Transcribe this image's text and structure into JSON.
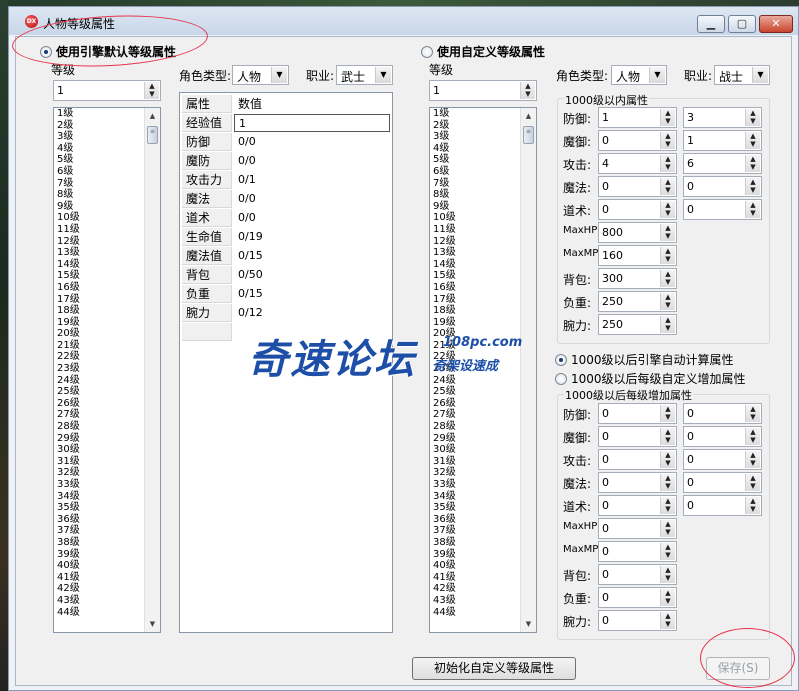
{
  "window": {
    "title": "人物等级属性",
    "icon_text": "DX"
  },
  "left_panel": {
    "radio_label": "使用引擎默认等级属性",
    "level_label": "等级",
    "level_value": "1",
    "role_type_label": "角色类型:",
    "role_type_value": "人物",
    "job_label": "职业:",
    "job_value": "武士",
    "grid_header": {
      "attr": "属性",
      "value": "数值"
    },
    "grid_rows": [
      {
        "name": "经验值",
        "value": "1"
      },
      {
        "name": "防御",
        "value": "0/0"
      },
      {
        "name": "魔防",
        "value": "0/0"
      },
      {
        "name": "攻击力",
        "value": "0/1"
      },
      {
        "name": "魔法",
        "value": "0/0"
      },
      {
        "name": "道术",
        "value": "0/0"
      },
      {
        "name": "生命值",
        "value": "0/19"
      },
      {
        "name": "魔法值",
        "value": "0/15"
      },
      {
        "name": "背包",
        "value": "0/50"
      },
      {
        "name": "负重",
        "value": "0/15"
      },
      {
        "name": "腕力",
        "value": "0/12"
      }
    ]
  },
  "right_panel": {
    "radio_label": "使用自定义等级属性",
    "level_label": "等级",
    "level_value": "1",
    "role_type_label": "角色类型:",
    "role_type_value": "人物",
    "job_label": "职业:",
    "job_value": "战士",
    "group1_label": "1000级以内属性",
    "group1_rows": [
      {
        "label": "防御:",
        "v1": "1",
        "v2": "3"
      },
      {
        "label": "魔御:",
        "v1": "0",
        "v2": "1"
      },
      {
        "label": "攻击:",
        "v1": "4",
        "v2": "6"
      },
      {
        "label": "魔法:",
        "v1": "0",
        "v2": "0"
      },
      {
        "label": "道术:",
        "v1": "0",
        "v2": "0"
      },
      {
        "label": "MaxHP",
        "v1": "800"
      },
      {
        "label": "MaxMP",
        "v1": "160"
      },
      {
        "label": "背包:",
        "v1": "300"
      },
      {
        "label": "负重:",
        "v1": "250"
      },
      {
        "label": "腕力:",
        "v1": "250"
      }
    ],
    "radio_auto": "1000级以后引擎自动计算属性",
    "radio_custom": "1000级以后每级自定义增加属性",
    "group2_label": "1000级以后每级增加属性",
    "group2_rows": [
      {
        "label": "防御:",
        "v1": "0",
        "v2": "0"
      },
      {
        "label": "魔御:",
        "v1": "0",
        "v2": "0"
      },
      {
        "label": "攻击:",
        "v1": "0",
        "v2": "0"
      },
      {
        "label": "魔法:",
        "v1": "0",
        "v2": "0"
      },
      {
        "label": "道术:",
        "v1": "0",
        "v2": "0"
      },
      {
        "label": "MaxHP",
        "v1": "0"
      },
      {
        "label": "MaxMP",
        "v1": "0"
      },
      {
        "label": "背包:",
        "v1": "0"
      },
      {
        "label": "负重:",
        "v1": "0"
      },
      {
        "label": "腕力:",
        "v1": "0"
      }
    ]
  },
  "level_list": [
    "1级",
    "2级",
    "3级",
    "4级",
    "5级",
    "6级",
    "7级",
    "8级",
    "9级",
    "10级",
    "11级",
    "12级",
    "13级",
    "14级",
    "15级",
    "16级",
    "17级",
    "18级",
    "19级",
    "20级",
    "21级",
    "22级",
    "23级",
    "24级",
    "25级",
    "26级",
    "27级",
    "28级",
    "29级",
    "30级",
    "31级",
    "32级",
    "33级",
    "34级",
    "35级",
    "36级",
    "37级",
    "38级",
    "39级",
    "40级",
    "41级",
    "42级",
    "43级",
    "44级"
  ],
  "buttons": {
    "init_custom": "初始化自定义等级属性",
    "save": "保存(S)"
  },
  "watermark": {
    "main": "奇速论坛",
    "url": "108pc.com",
    "slogan": "奇架设速成"
  },
  "colors": {
    "watermark": "#1d4fa8",
    "annotation": "#e8324a"
  }
}
